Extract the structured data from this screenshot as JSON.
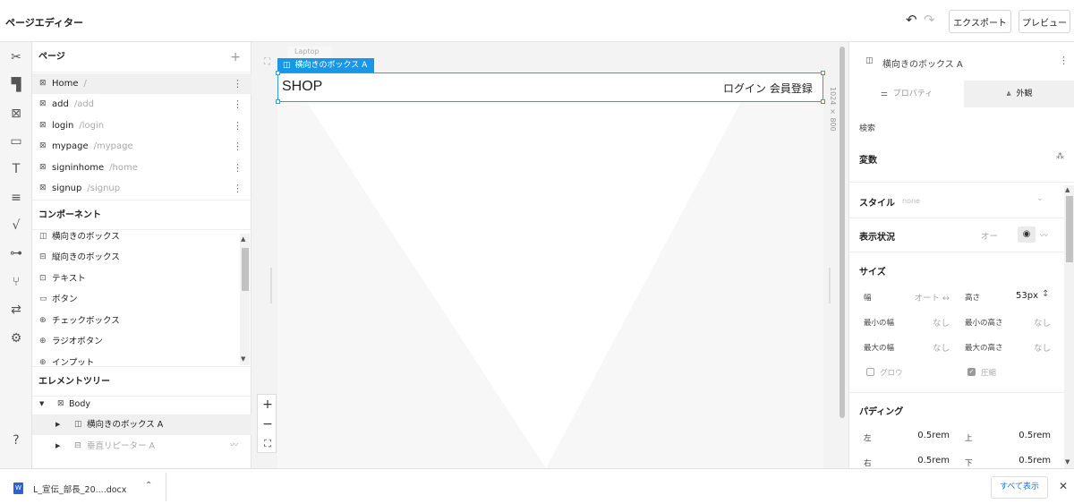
{
  "app": {
    "title": "ページエディター"
  },
  "toolbar": {
    "undo_icon": "undo-icon",
    "redo_icon": "redo-icon",
    "export_label": "エクスポート",
    "preview_label": "プレビュー"
  },
  "rail": {
    "icons": [
      "magic-tools-icon",
      "paint-roller-icon",
      "frame-icon",
      "monitor-icon",
      "typography-icon",
      "database-icon",
      "formula-icon",
      "workflow-icon",
      "branch-icon",
      "translate-icon",
      "gear-icon",
      "help-icon"
    ]
  },
  "pages": {
    "header": "ページ",
    "add_label": "+",
    "items": [
      {
        "name": "Home",
        "path": "/"
      },
      {
        "name": "add",
        "path": "/add"
      },
      {
        "name": "login",
        "path": "/login"
      },
      {
        "name": "mypage",
        "path": "/mypage"
      },
      {
        "name": "signinhome",
        "path": "/home"
      },
      {
        "name": "signup",
        "path": "/signup"
      }
    ]
  },
  "components": {
    "header": "コンポーネント",
    "items": [
      {
        "label": "横向きのボックス",
        "glyph": "◫"
      },
      {
        "label": "縦向きのボックス",
        "glyph": "⊟"
      },
      {
        "label": "テキスト",
        "glyph": "⊡"
      },
      {
        "label": "ボタン",
        "glyph": "▭"
      },
      {
        "label": "チェックボックス",
        "glyph": "⊕"
      },
      {
        "label": "ラジオボタン",
        "glyph": "⊕"
      },
      {
        "label": "インプット",
        "glyph": "⊕"
      }
    ]
  },
  "tree": {
    "header": "エレメントツリー",
    "items": [
      {
        "label": "Body"
      },
      {
        "label": "横向きのボックス A"
      },
      {
        "label": "垂直リピーター A"
      }
    ]
  },
  "canvas": {
    "device_tab": "Laptop",
    "selection_tag": "横向きのボックス A",
    "size_label": "1024 × 800",
    "header_logo": "SHOP",
    "header_links": "ログイン 会員登録",
    "zoom_in": "+",
    "zoom_out": "−",
    "fit": "⛶"
  },
  "inspector": {
    "title": "横向きのボックス A",
    "tab_properties": "プロパティ",
    "tab_appearance": "外観",
    "search_label": "検索",
    "variables": "変数",
    "style_label": "スタイル",
    "style_value": "none",
    "visibility_label": "表示状況",
    "visibility_value": "オー",
    "size_header": "サイズ",
    "width_label": "幅",
    "width_value": "オート ↔",
    "height_label": "高さ",
    "height_value": "53px",
    "min_width_label": "最小の幅",
    "min_width_value": "なし",
    "min_height_label": "最小の高さ",
    "min_height_value": "なし",
    "max_width_label": "最大の幅",
    "max_width_value": "なし",
    "max_height_label": "最大の高さ",
    "max_height_value": "なし",
    "grow_label": "グロウ",
    "shrink_label": "圧縮",
    "padding_header": "パディング",
    "pad_left_label": "左",
    "pad_left_value": "0.5rem",
    "pad_top_label": "上",
    "pad_top_value": "0.5rem",
    "pad_right_label": "右",
    "pad_right_value": "0.5rem",
    "pad_bottom_label": "下",
    "pad_bottom_value": "0.5rem"
  },
  "downloads": {
    "file_name": "L_宣伝_部長_20....docx",
    "show_all": "すべて表示"
  }
}
